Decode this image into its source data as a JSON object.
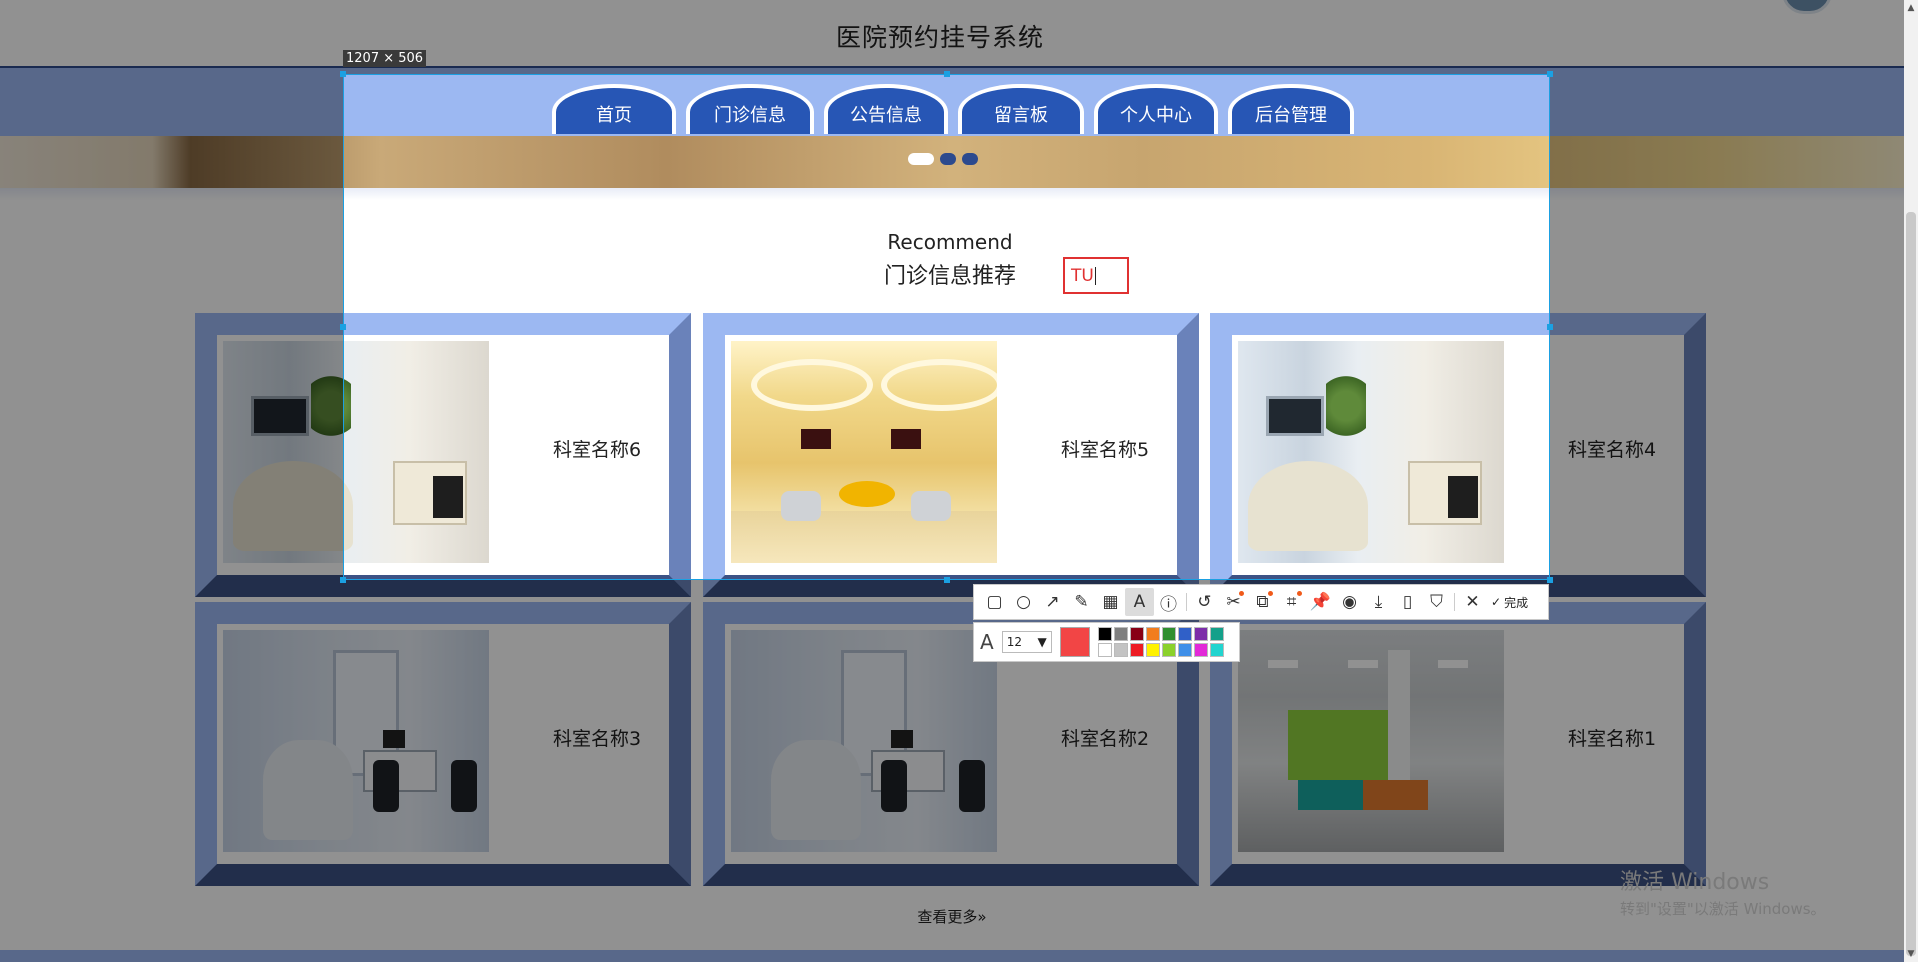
{
  "site": {
    "title": "医院预约挂号系统"
  },
  "nav": {
    "items": [
      {
        "label": "首页"
      },
      {
        "label": "门诊信息"
      },
      {
        "label": "公告信息"
      },
      {
        "label": "留言板"
      },
      {
        "label": "个人中心"
      },
      {
        "label": "后台管理"
      }
    ]
  },
  "carousel": {
    "dot_count": 3,
    "active_index": 0
  },
  "recommend": {
    "english": "Recommend",
    "chinese": "门诊信息推荐"
  },
  "departments": [
    {
      "name": "科室名称6",
      "photo": "dental-room"
    },
    {
      "name": "科室名称5",
      "photo": "yellow-lobby"
    },
    {
      "name": "科室名称4",
      "photo": "dental-room"
    },
    {
      "name": "科室名称3",
      "photo": "blue-clinic"
    },
    {
      "name": "科室名称2",
      "photo": "blue-clinic"
    },
    {
      "name": "科室名称1",
      "photo": "waiting-hall"
    }
  ],
  "more": {
    "label": "查看更多",
    "icon": "double-chevron-right-icon"
  },
  "screenshot_tool": {
    "selection_size": "1207 × 506",
    "text_input_value": "TU",
    "toolbar": {
      "tools": [
        "rectangle-icon",
        "ellipse-icon",
        "arrow-icon",
        "pencil-icon",
        "mosaic-icon",
        "text-icon",
        "number-icon",
        "undo-icon",
        "cut-icon",
        "translate-icon",
        "ocr-icon",
        "pin-icon",
        "record-icon",
        "download-icon",
        "phone-icon",
        "bookmark-icon",
        "close-icon",
        "check-icon"
      ],
      "active_tool": "text-icon",
      "done_label": "完成"
    },
    "text_options": {
      "font_size": "12",
      "current_color": "#f24545",
      "palette": [
        "#000000",
        "#7f7f7f",
        "#880015",
        "#f27d1d",
        "#2f8f2f",
        "#3060c8",
        "#7d2ea8",
        "#14a08a",
        "#ffffff",
        "#c3c3c3",
        "#ed1c24",
        "#fff200",
        "#8bd12c",
        "#3f8fe8",
        "#e22ad8",
        "#22d4cf"
      ]
    }
  },
  "os_watermark": {
    "line1": "激活 Windows",
    "line2": "转到\"设置\"以激活 Windows。"
  },
  "colors": {
    "nav_blue": "#2756b5",
    "nav_band": "#9cb8f2",
    "selection_border": "#1ba0e2",
    "annotation_red": "#e03131"
  }
}
